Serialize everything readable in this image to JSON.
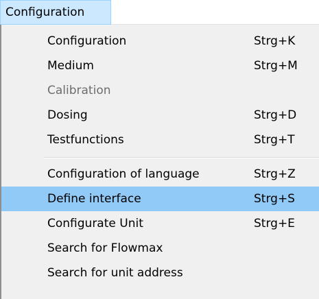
{
  "menubar": {
    "active_menu": "Configuration"
  },
  "dropdown": {
    "items": [
      {
        "label": "Configuration",
        "shortcut": "Strg+K",
        "enabled": true
      },
      {
        "label": "Medium",
        "shortcut": "Strg+M",
        "enabled": true
      },
      {
        "label": "Calibration",
        "shortcut": "",
        "enabled": false
      },
      {
        "label": "Dosing",
        "shortcut": "Strg+D",
        "enabled": true
      },
      {
        "label": "Testfunctions",
        "shortcut": "Strg+T",
        "enabled": true
      },
      {
        "label": "Configuration of language",
        "shortcut": "Strg+Z",
        "enabled": true
      },
      {
        "label": "Define interface",
        "shortcut": "Strg+S",
        "enabled": true,
        "highlighted": true
      },
      {
        "label": "Configurate Unit",
        "shortcut": "Strg+E",
        "enabled": true
      },
      {
        "label": "Search for Flowmax",
        "shortcut": "",
        "enabled": true
      },
      {
        "label": "Search for unit address",
        "shortcut": "",
        "enabled": true
      }
    ]
  },
  "colors": {
    "menubar_active_bg": "#cce8ff",
    "menubar_active_border": "#99d1ff",
    "menu_bg": "#f0f0f0",
    "highlight_bg": "#91c9f7",
    "disabled_text": "#6d6d6d"
  }
}
